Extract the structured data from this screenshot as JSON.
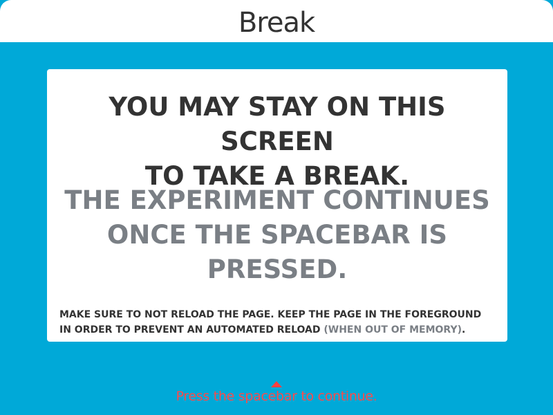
{
  "header": {
    "title": "Break"
  },
  "card": {
    "primary_line_1": "YOU MAY STAY ON THIS SCREEN",
    "primary_line_2": "TO TAKE A BREAK.",
    "secondary_line_1": "THE EXPERIMENT CONTINUES",
    "secondary_line_2": "ONCE THE SPACEBAR IS",
    "secondary_line_3": "PRESSED.",
    "note_part_1": "MAKE SURE TO NOT RELOAD THE PAGE. KEEP THE PAGE IN THE FOREGROUND IN ORDER TO PREVENT AN AUTOMATED RELOAD ",
    "note_highlight": "(WHEN OUT OF MEMORY)",
    "note_end": "."
  },
  "footer": {
    "continue_text": "Press the spacebar to continue.",
    "caret_icon": "caret-up-icon"
  },
  "colors": {
    "background": "#00A9D8",
    "card": "#ffffff",
    "primary_text": "#333333",
    "secondary_text": "#7a7f85",
    "accent": "#ff4a4a"
  }
}
